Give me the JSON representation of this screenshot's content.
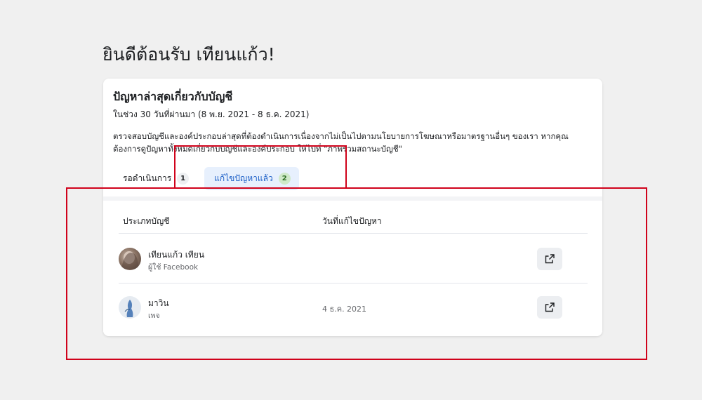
{
  "page": {
    "welcome": "ยินดีต้อนรับ เทียนแก้ว!"
  },
  "card": {
    "title": "ปัญหาล่าสุดเกี่ยวกับบัญชี",
    "subtitle": "ในช่วง 30 วันที่ผ่านมา (8 พ.ย. 2021 - 8 ธ.ค. 2021)",
    "description_line1": "ตรวจสอบบัญชีและองค์ประกอบล่าสุดที่ต้องดำเนินการเนื่องจากไม่เป็นไปตามนโยบายการโฆษณาหรือมาตรฐานอื่นๆ ของเรา หากคุณ",
    "description_line2": "ต้องการดูปัญหาทั้งหมดเกี่ยวกับบัญชีและองค์ประกอบ ให้ไปที่ \"ภาพรวมสถานะบัญชี\""
  },
  "tabs": [
    {
      "label": "รอดำเนินการ",
      "count": "1",
      "active": false
    },
    {
      "label": "แก้ไขปัญหาแล้ว",
      "count": "2",
      "active": true
    }
  ],
  "table": {
    "columns": [
      "ประเภทบัญชี",
      "วันที่แก้ไขปัญหา"
    ],
    "rows": [
      {
        "name": "เทียนแก้ว เทียน",
        "type": "ผู้ใช้ Facebook",
        "date": "",
        "icon": "external-link-icon"
      },
      {
        "name": "มาวิน",
        "type": "เพจ",
        "date": "4 ธ.ค. 2021",
        "icon": "external-link-icon"
      }
    ]
  },
  "colors": {
    "highlight": "#d0021b",
    "active_tab_bg": "#e7f0fd",
    "active_tab_text": "#1a5ec7",
    "badge_green": "#cfe9c9"
  }
}
